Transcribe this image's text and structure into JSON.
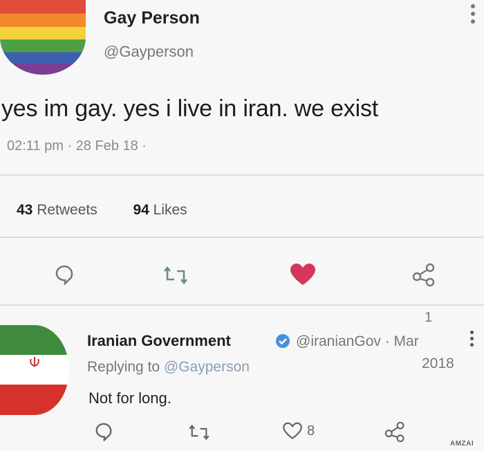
{
  "tweet": {
    "author_name": "Gay Person",
    "author_handle": "@Gayperson",
    "text": "yes im gay. yes i live in iran. we exist",
    "meta": "02:11 pm · 28 Feb 18 ·",
    "retweets_count": "43",
    "retweets_label": "Retweets",
    "likes_count": "94",
    "likes_label": "Likes",
    "colors": {
      "like_active": "#d4375a",
      "retweet": "#6b8f7a",
      "icon": "#777777"
    }
  },
  "reply": {
    "author_name": "Iranian Government",
    "author_handle": "@iranianGov · Mar",
    "date_day": "1",
    "date_year": "2018",
    "replying_prefix": "Replying to",
    "replying_mention": "@Gayperson",
    "text": "Not for long.",
    "like_count": "8",
    "colors": {
      "verified": "#4a90d9",
      "mention": "#8a9fb5"
    }
  },
  "watermark": "AMZAI",
  "icons": [
    "comment-icon",
    "retweet-icon",
    "heart-icon",
    "share-icon",
    "verified-icon",
    "more-icon"
  ]
}
